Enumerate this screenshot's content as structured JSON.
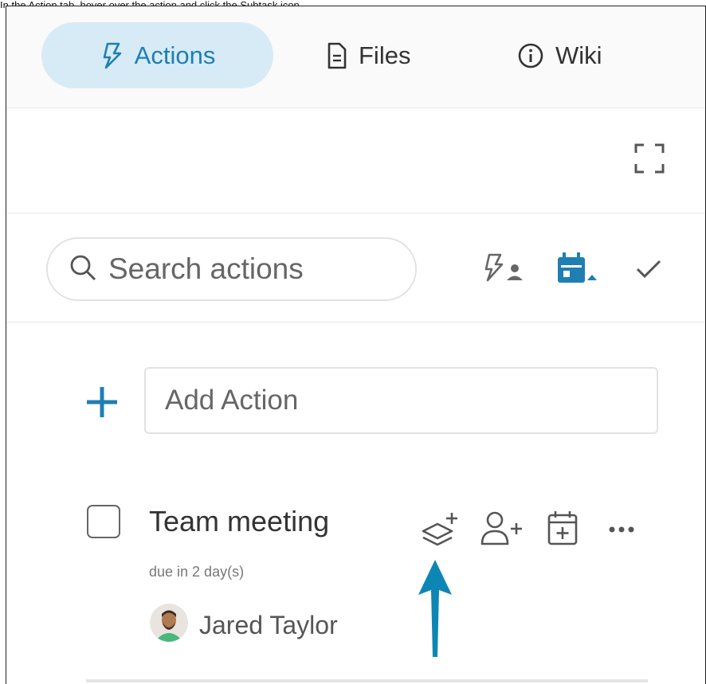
{
  "caption": "In the Action tab, hover over the action and click the Subtask icon.",
  "tabs": [
    {
      "label": "Actions",
      "icon": "lightning-icon",
      "active": true
    },
    {
      "label": "Files",
      "icon": "document-icon",
      "active": false
    },
    {
      "label": "Wiki",
      "icon": "info-icon",
      "active": false
    }
  ],
  "toolbar": {
    "expand_icon": "expand-icon"
  },
  "search": {
    "placeholder": "Search actions",
    "filters": [
      "assigned-to-me-icon",
      "due-date-filter-icon",
      "completed-check-icon"
    ]
  },
  "add_action": {
    "placeholder": "Add Action"
  },
  "action": {
    "title": "Team meeting",
    "due": "due in 2 day(s)",
    "assignee": "Jared Taylor",
    "checked": false,
    "hover_icons": [
      "add-subtask-icon",
      "add-assignee-icon",
      "add-date-icon",
      "more-icon"
    ]
  },
  "annotation": {
    "pointer": "blue-arrow",
    "target": "add-subtask-icon"
  },
  "colors": {
    "accent": "#1f7fb2",
    "active_tab_bg": "#d6ebf5",
    "arrow": "#0d86b5",
    "icon_gray": "#666666"
  }
}
